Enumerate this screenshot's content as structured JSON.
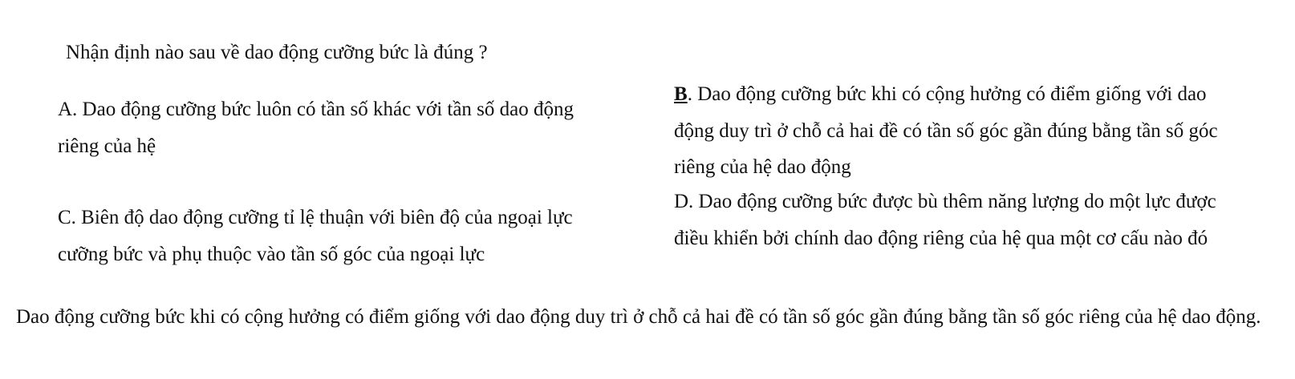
{
  "question": "Nhận định nào sau về dao động cưỡng bức là đúng ?",
  "options": {
    "a": {
      "text": "A. Dao động cưỡng bức luôn có tần số khác với tần số dao động riêng của hệ"
    },
    "b": {
      "letter": "B",
      "text": ". Dao động cưỡng bức khi có cộng hưởng có điểm giống với dao động duy trì ở chỗ cả hai đề có tần số góc gần đúng bằng tần số góc riêng của hệ dao động"
    },
    "c": {
      "text": "C. Biên độ dao động cưỡng tỉ lệ thuận với biên độ của ngoại lực cưỡng bức và phụ thuộc vào tần số góc của ngoại lực"
    },
    "d": {
      "text": "D. Dao động cưỡng bức được bù thêm năng lượng do một lực được điều khiển bởi chính dao động riêng của hệ qua một cơ cấu nào đó"
    }
  },
  "explanation": "Dao động cưỡng bức khi có cộng hưởng có điểm giống với dao động duy trì ở chỗ cả hai đề có tần số góc gần đúng bằng tần số góc riêng của hệ dao động."
}
